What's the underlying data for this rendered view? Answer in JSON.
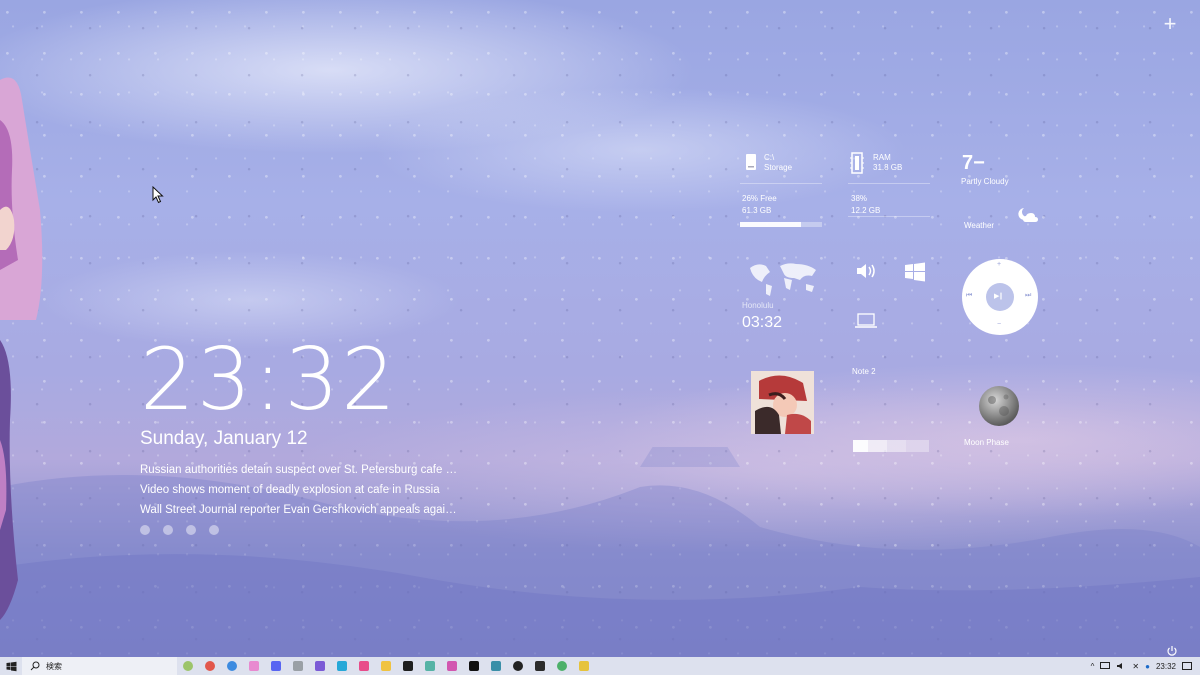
{
  "clock": {
    "time": "23:32",
    "date": "Sunday, January 12"
  },
  "news": [
    "Russian authorities detain suspect over St. Petersburg cafe b...",
    "Video shows moment of deadly explosion at cafe in Russia",
    "Wall Street Journal reporter Evan Gershkovich appeals again..."
  ],
  "storage": {
    "drive": "C:\\",
    "label": "Storage",
    "free": "26% Free",
    "size": "61.3 GB",
    "used_fraction": 0.74
  },
  "ram": {
    "label": "RAM",
    "total": "31.8 GB",
    "percent": "38%",
    "used": "12.2 GB"
  },
  "weather": {
    "temp": "7−",
    "condition": "Partly Cloudy",
    "label": "Weather"
  },
  "world_clock": {
    "city": "Honolulu",
    "time": "03:32"
  },
  "note": {
    "title": "Note 2"
  },
  "moon": {
    "label": "Moon Phase"
  },
  "taskbar": {
    "search_placeholder": "検索",
    "time": "23:32"
  }
}
